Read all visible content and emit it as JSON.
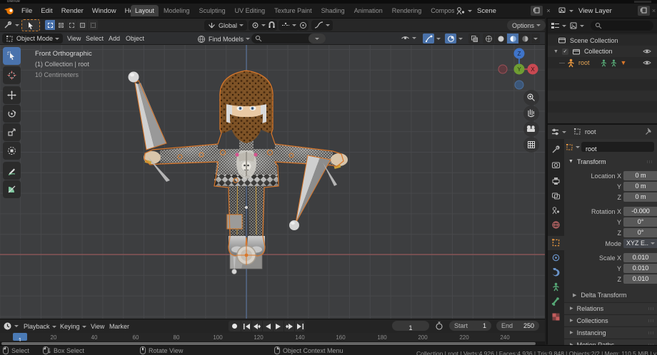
{
  "titlebar": {
    "title": "blende"
  },
  "menubar": {
    "menus": [
      "File",
      "Edit",
      "Render",
      "Window",
      "Help"
    ],
    "tabs": [
      "Layout",
      "Modeling",
      "Sculpting",
      "UV Editing",
      "Texture Paint",
      "Shading",
      "Animation",
      "Rendering",
      "Compos"
    ],
    "active_tab": "Layout",
    "scene_selector": {
      "value": "Scene"
    },
    "view_layer_selector": {
      "value": "View Layer"
    }
  },
  "tool_settings": {
    "orientation": "Global",
    "options_label": "Options"
  },
  "viewport_header": {
    "mode": "Object Mode",
    "menus": [
      "View",
      "Select",
      "Add",
      "Object"
    ],
    "asset_search_label": "Find Models"
  },
  "viewport": {
    "overlay_line1": "Front Orthographic",
    "overlay_line2": "(1) Collection | root",
    "overlay_line3": "10 Centimeters",
    "gizmo_x": "X",
    "gizmo_y": "Y",
    "gizmo_z": "Z"
  },
  "outliner": {
    "rows": [
      {
        "label": "Scene Collection"
      },
      {
        "label": "Collection"
      },
      {
        "label": "root"
      }
    ]
  },
  "properties": {
    "breadcrumb": "root",
    "object_name": "root",
    "transform_title": "Transform",
    "fields": [
      {
        "label": "Location X",
        "value": "0 m"
      },
      {
        "label": "Y",
        "value": "0 m"
      },
      {
        "label": "Z",
        "value": "0 m"
      },
      {
        "label": "Rotation X",
        "value": "-0.000"
      },
      {
        "label": "Y",
        "value": "0°"
      },
      {
        "label": "Z",
        "value": "0°"
      },
      {
        "label": "Mode",
        "value": "XYZ E.."
      },
      {
        "label": "Scale X",
        "value": "0.010"
      },
      {
        "label": "Y",
        "value": "0.010"
      },
      {
        "label": "Z",
        "value": "0.010"
      }
    ],
    "delta_label": "Delta Transform",
    "sections": [
      "Relations",
      "Collections",
      "Instancing",
      "Motion Paths"
    ]
  },
  "timeline": {
    "menus": [
      "Playback",
      "Keying",
      "View",
      "Marker"
    ],
    "current_frame": "1",
    "playhead": "1",
    "start_label": "Start",
    "start_value": "1",
    "end_label": "End",
    "end_value": "250",
    "ticks": [
      "20",
      "40",
      "60",
      "80",
      "100",
      "120",
      "140",
      "160",
      "180",
      "200",
      "220",
      "240"
    ]
  },
  "statusbar": {
    "hints": [
      "Select",
      "Box Select",
      "Rotate View",
      "Object Context Menu"
    ],
    "stats": "Collection | root | Verts:4,926 | Faces:4,936 | Tris:9,848 | Objects:2/2 | Mem: 110.5 MiB | v"
  },
  "colors": {
    "accent_blue": "#4a72aa",
    "selection_orange": "#e8832a",
    "axis_x": "#a04848",
    "axis_z": "#5577aa"
  }
}
